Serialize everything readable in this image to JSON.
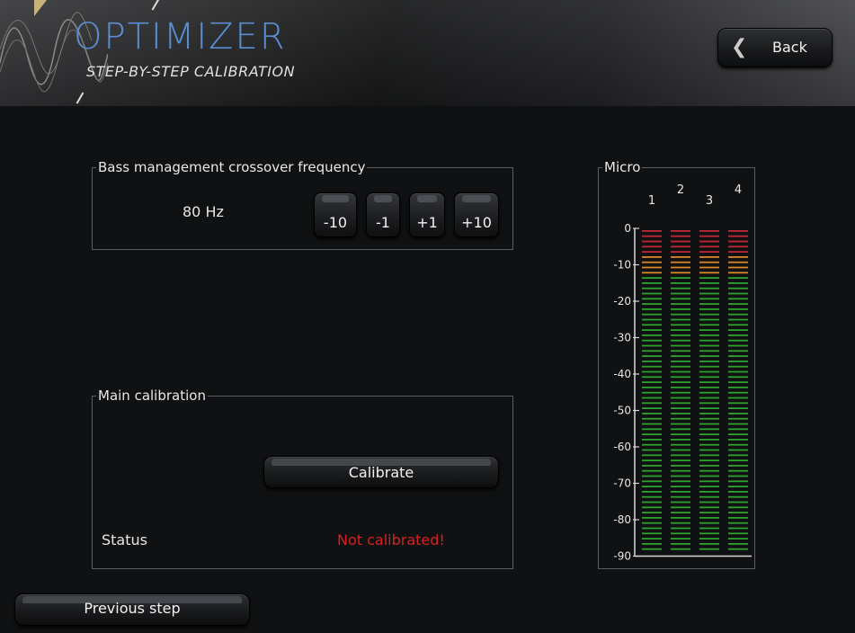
{
  "header": {
    "title": "OPTIMIZER",
    "subtitle": "STEP-BY-STEP CALIBRATION",
    "back_label": "Back"
  },
  "crossover": {
    "group_title": "Bass management crossover frequency",
    "value": "80 Hz",
    "buttons": [
      "-10",
      "-1",
      "+1",
      "+10"
    ]
  },
  "calibration": {
    "group_title": "Main calibration",
    "button_label": "Calibrate",
    "status_label": "Status",
    "status_value": "Not calibrated!",
    "status_color": "#d42222"
  },
  "micro": {
    "group_title": "Micro",
    "channels": [
      "1",
      "2",
      "3",
      "4"
    ],
    "scale": [
      "0",
      "-10",
      "-20",
      "-30",
      "-40",
      "-50",
      "-60",
      "-70",
      "-80",
      "-90"
    ],
    "colors": {
      "red": "#c0283a",
      "orange": "#d9872a",
      "green": "#2fa12f"
    }
  },
  "footer": {
    "previous_label": "Previous step"
  }
}
